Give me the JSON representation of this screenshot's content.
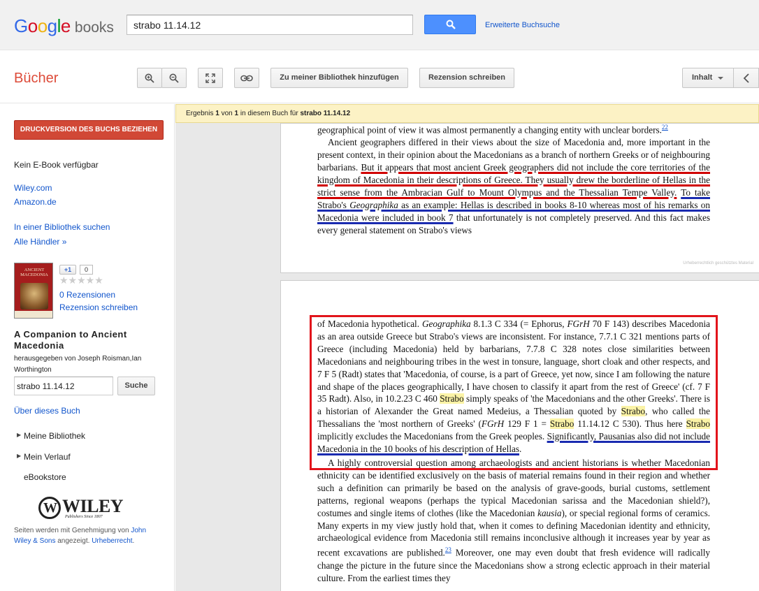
{
  "header": {
    "logo_google": "Google",
    "logo_books": "books",
    "search_value": "strabo 11.14.12",
    "advanced_search": "Erweiterte Buchsuche"
  },
  "toolbar": {
    "title": "Bücher",
    "add_library": "Zu meiner Bibliothek hinzufügen",
    "write_review": "Rezension schreiben",
    "contents": "Inhalt"
  },
  "sidebar": {
    "print_button": "DRUCKVERSION DES BUCHS BEZIEHEN",
    "no_ebook": "Kein E-Book verfügbar",
    "seller1": "Wiley.com",
    "seller2": "Amazon.de",
    "find_library": "In einer Bibliothek suchen",
    "all_sellers": "Alle Händler »",
    "cover_title": "ANCIENT MACEDONIA",
    "plus_one": "+1",
    "plus_count": "0",
    "stars": "★★★★★",
    "reviews_count": "0 Rezensionen",
    "write_review": "Rezension schreiben",
    "book_title": "A Companion to Ancient Macedonia",
    "editors": "herausgegeben von Joseph Roisman,Ian Worthington",
    "inbook_value": "strabo 11.14.12",
    "inbook_button": "Suche",
    "about_book": "Über dieses Buch",
    "my_library": "Meine Bibliothek",
    "my_history": "Mein Verlauf",
    "ebookstore": "eBookstore",
    "wiley_logo": "WILEY",
    "wiley_sub": "Publishers Since 1807",
    "footnote_pre": "Seiten werden mit Genehmigung von ",
    "footnote_publisher": "John Wiley & Sons",
    "footnote_mid": " angezeigt. ",
    "footnote_copyright": "Urheberrecht",
    "footnote_end": "."
  },
  "result": {
    "prefix": "Ergebnis ",
    "current": "1",
    "mid": " von ",
    "total": "1",
    "suffix": " in diesem Buch für ",
    "query": "strabo 11.14.12"
  },
  "page1": {
    "line0": "geographical point of view it was almost permanently a changing entity with unclear borders.",
    "fn0": "22",
    "p1_a": "Ancient geographers differed in their views about the size of Macedonia and, more important in the present context, in their opinion about the Macedonians as a branch of northern Greeks or of neighbouring barbarians. ",
    "p1_red": "But it appears that most ancient Greek geographers did not include the core territories of the kingdom of Macedonia in their descriptions of Greece. They usually drew the borderline of Hellas in the strict sense from the Ambracian Gulf to Mount Olympus and the Thessalian Tempe Valley.",
    "p1_blue_a": "To take Strabo's ",
    "p1_blue_em": "Geographika",
    "p1_blue_b": " as an example: Hellas is described in books 8-10 whereas most of his remarks on Macedonia were included in book 7",
    "p1_end": " that unfortunately is not completely preserved. And this fact makes every general statement on Strabo's views",
    "watermark": "Urheberrechtlich geschütztes Material"
  },
  "page2": {
    "t1": "of Macedonia hypothetical. ",
    "t1em": "Geographika",
    "t2": " 8.1.3 C 334 (= Ephorus, ",
    "t2em": "FGrH",
    "t3": " 70 F 143) describes Macedonia as an area outside Greece but Strabo's views are inconsistent. For instance, 7.7.1 C 321 mentions parts of Greece (including Macedonia) held by barbarians, 7.7.8 C 328 notes close similarities between Macedonians and neighbouring tribes in the west in tonsure, language, short cloak and other respects, and 7 F 5 (Radt) states that 'Macedonia, of course, is a part of Greece, yet now, since I am following the nature and shape of the places geographically, I have chosen to classify it apart from the rest of Greece' (cf. 7 F 35 Radt). Also, in 10.2.23 C 460 ",
    "hl1": "Strabo",
    "t4": " simply speaks of 'the Macedonians and the other Greeks'. There is a historian of Alexander the Great named Medeius, a Thessalian quoted by ",
    "hl2": "Strabo",
    "t5": ", who called the Thessalians the 'most northern of Greeks' (",
    "t5em": "FGrH",
    "t6": " 129 F 1 = ",
    "hl3": "Strabo",
    "t7": " 11.14.12 C 530). Thus here ",
    "hl4": "Strabo",
    "t8": " implicitly excludes the Macedonians from the Greek peoples. ",
    "blue": "Significantly, Pausanias also did not include Macedonia in the 10 books of his description of Hellas",
    "t9": ".",
    "p2a": "A highly controversial question among archaeologists and ancient historians is whether Macedonian ethnicity can be identified exclusively on the basis of material remains found in their region and whether such a definition can primarily be based on the analysis of grave-goods, burial customs, settlement patterns, regional weapons (perhaps the typical Macedonian sarissa and the Macedonian shield?), costumes and single items of clothes (like the Macedonian ",
    "p2em": "kausia",
    "p2b": "), or special regional forms of ceramics. Many experts in my view justly hold that, when it comes to defining Macedonian identity and ethnicity, archaeological evidence from Macedonia still remains inconclusive although it increases year by year as recent excavations are published.",
    "fn23": "23",
    "p2c": " Moreover, one may even doubt that fresh evidence will radically change the picture in the future since the Macedonians show a strong eclectic approach in their material culture. From the earliest times they"
  }
}
